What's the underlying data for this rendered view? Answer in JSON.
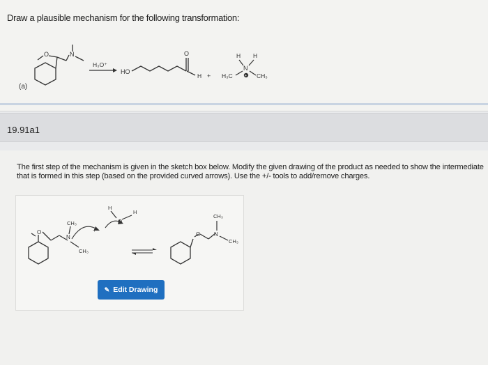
{
  "question": {
    "title": "Draw a plausible mechanism for the following transformation:",
    "part_label": "(a)",
    "reagent": "H₃O⁺",
    "plus": "+",
    "ho": "HO",
    "h": "H",
    "n": "N",
    "o": "O",
    "amine_h": "H",
    "methyl_left": "H₃C",
    "methyl_right": "CH₃"
  },
  "problem": {
    "id": "19.91a1"
  },
  "instructions": {
    "text": "The first step of the mechanism is given in the sketch box below. Modify the given drawing of the product as needed to show the intermediate that is formed in this step (based on the provided curved arrows). Use the +/- tools to add/remove charges."
  },
  "sketch": {
    "ch3_top": "CH₃",
    "ch3_bottom": "CH₃",
    "plus": "+",
    "h_top": "H",
    "h_right": "H",
    "o": "O",
    "n": "N",
    "prod_ch3_top": "CH₃",
    "prod_ch3_right": "CH₃",
    "edit_label": "Edit Drawing"
  }
}
